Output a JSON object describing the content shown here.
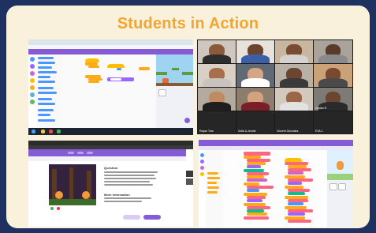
{
  "slide": {
    "title": "Students in Action"
  },
  "colors": {
    "background": "#1f3160",
    "card": "#faf1dc",
    "title": "#f2a531",
    "scratch_purple": "#855cd6",
    "motion_blue": "#4c97ff",
    "looks_purple": "#9966ff",
    "events_yellow": "#ffbf00",
    "control_orange": "#ffab19",
    "pen_green": "#0fbd8c",
    "sound_pink": "#cf63cf",
    "operators_red": "#ff6680"
  },
  "video_call": {
    "participants": [
      {
        "name": ""
      },
      {
        "name": ""
      },
      {
        "name": ""
      },
      {
        "name": ""
      },
      {
        "name": ""
      },
      {
        "name": ""
      },
      {
        "name": ""
      },
      {
        "name": ""
      },
      {
        "name": ""
      },
      {
        "name": ""
      },
      {
        "name": ""
      },
      {
        "name": "Jordan R."
      },
      {
        "name": "Rayan Tran"
      },
      {
        "name": "Sofia & Jendie"
      },
      {
        "name": "Vincent Gonzales"
      },
      {
        "name": "EVA J."
      }
    ]
  },
  "scratch_tutorial": {
    "heading": "Question",
    "sub_heading": "More Information"
  }
}
